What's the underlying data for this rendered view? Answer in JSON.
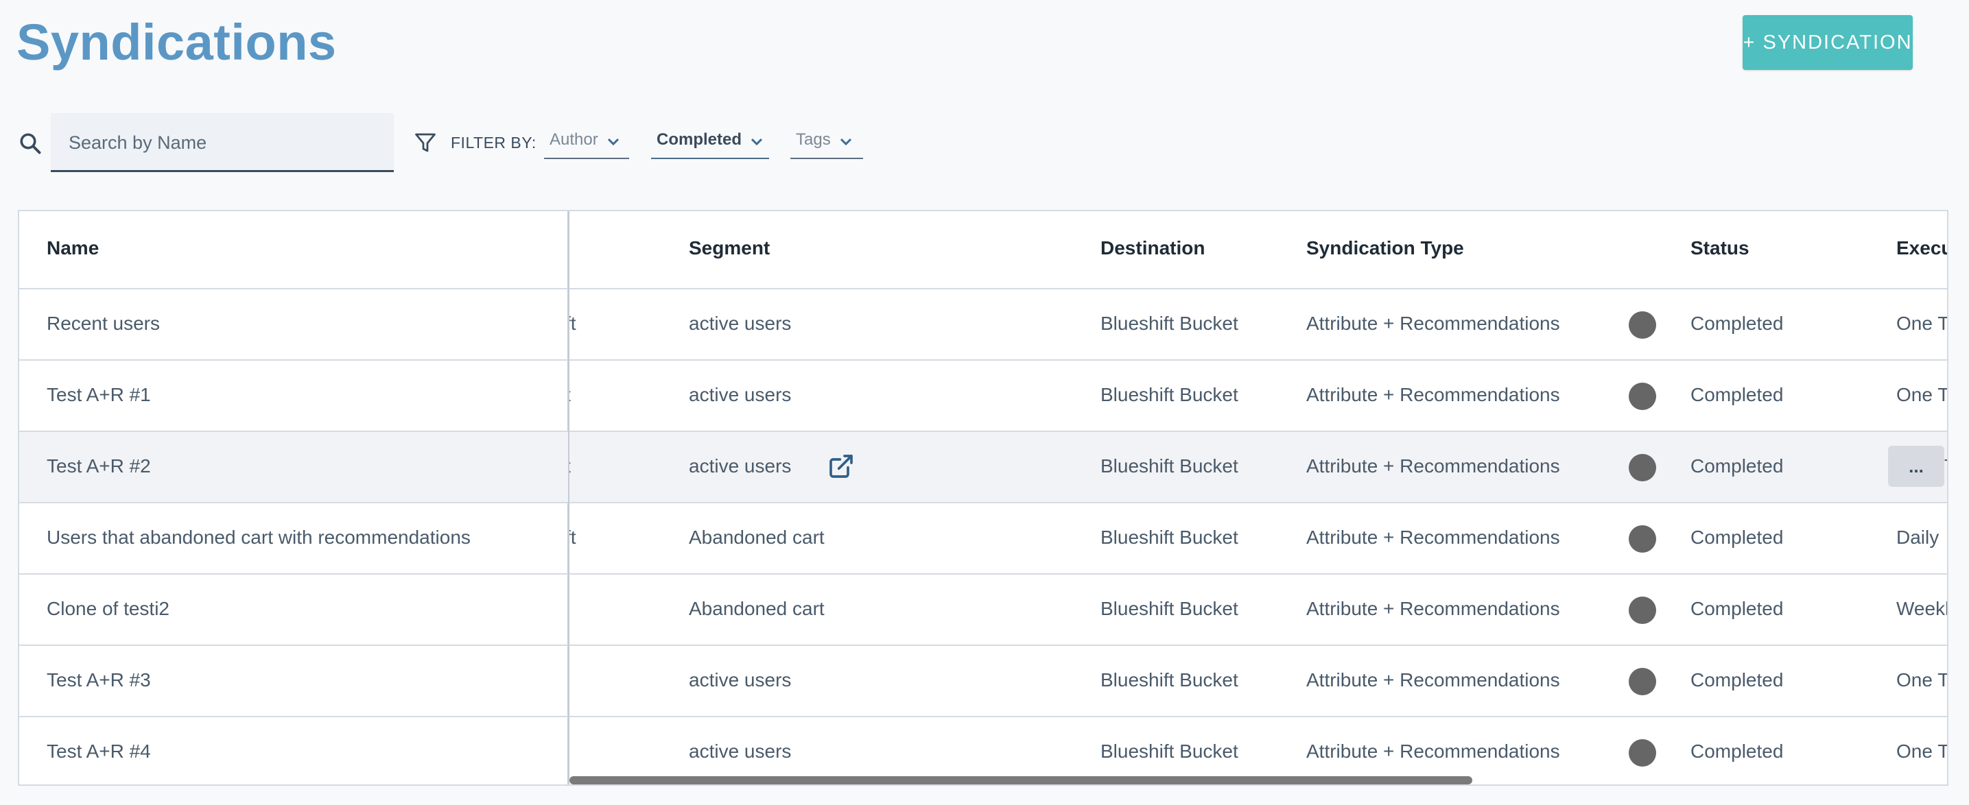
{
  "page": {
    "title": "Syndications"
  },
  "toolbar": {
    "add_label": "+ SYNDICATION",
    "search_placeholder": "Search by Name",
    "filter_label": "FILTER BY:",
    "filters": [
      {
        "label": "Author",
        "active": false
      },
      {
        "label": "Completed",
        "active": true
      },
      {
        "label": "Tags",
        "active": false
      }
    ]
  },
  "table": {
    "columns": {
      "name": "Name",
      "segment": "Segment",
      "destination": "Destination",
      "type": "Syndication Type",
      "status": "Status",
      "execution": "Execu"
    },
    "rows": [
      {
        "name": "Recent users",
        "hidden_fragment": "ft",
        "segment": "active users",
        "destination": "Blueshift Bucket",
        "type": "Attribute + Recommendations",
        "status": "Completed",
        "execution": "One T"
      },
      {
        "name": "Test A+R #1",
        "hidden_fragment": "t",
        "segment": "active users",
        "destination": "Blueshift Bucket",
        "type": "Attribute + Recommendations",
        "status": "Completed",
        "execution": "One T"
      },
      {
        "name": "Test A+R #2",
        "hidden_fragment": "t",
        "segment": "active users",
        "destination": "Blueshift Bucket",
        "type": "Attribute + Recommendations",
        "status": "Completed",
        "execution": "T",
        "more_label": "..."
      },
      {
        "name": "Users that abandoned cart with recommendations",
        "hidden_fragment": "ft",
        "segment": "Abandoned cart",
        "destination": "Blueshift Bucket",
        "type": "Attribute + Recommendations",
        "status": "Completed",
        "execution": "Daily"
      },
      {
        "name": "Clone of testi2",
        "hidden_fragment": "",
        "segment": "Abandoned cart",
        "destination": "Blueshift Bucket",
        "type": "Attribute + Recommendations",
        "status": "Completed",
        "execution": "Weekl"
      },
      {
        "name": "Test A+R #3",
        "hidden_fragment": "",
        "segment": "active users",
        "destination": "Blueshift Bucket",
        "type": "Attribute + Recommendations",
        "status": "Completed",
        "execution": "One T"
      },
      {
        "name": "Test A+R #4",
        "hidden_fragment": "",
        "segment": "active users",
        "destination": "Blueshift Bucket",
        "type": "Attribute + Recommendations",
        "status": "Completed",
        "execution": "One T"
      }
    ]
  },
  "colors": {
    "title": "#5b97c5",
    "primary_button": "#4fbfbf",
    "status_dot": "#666666"
  },
  "icons": [
    "search-icon",
    "filter-icon",
    "chevron-down-icon",
    "external-link-icon",
    "status-dot-icon"
  ]
}
